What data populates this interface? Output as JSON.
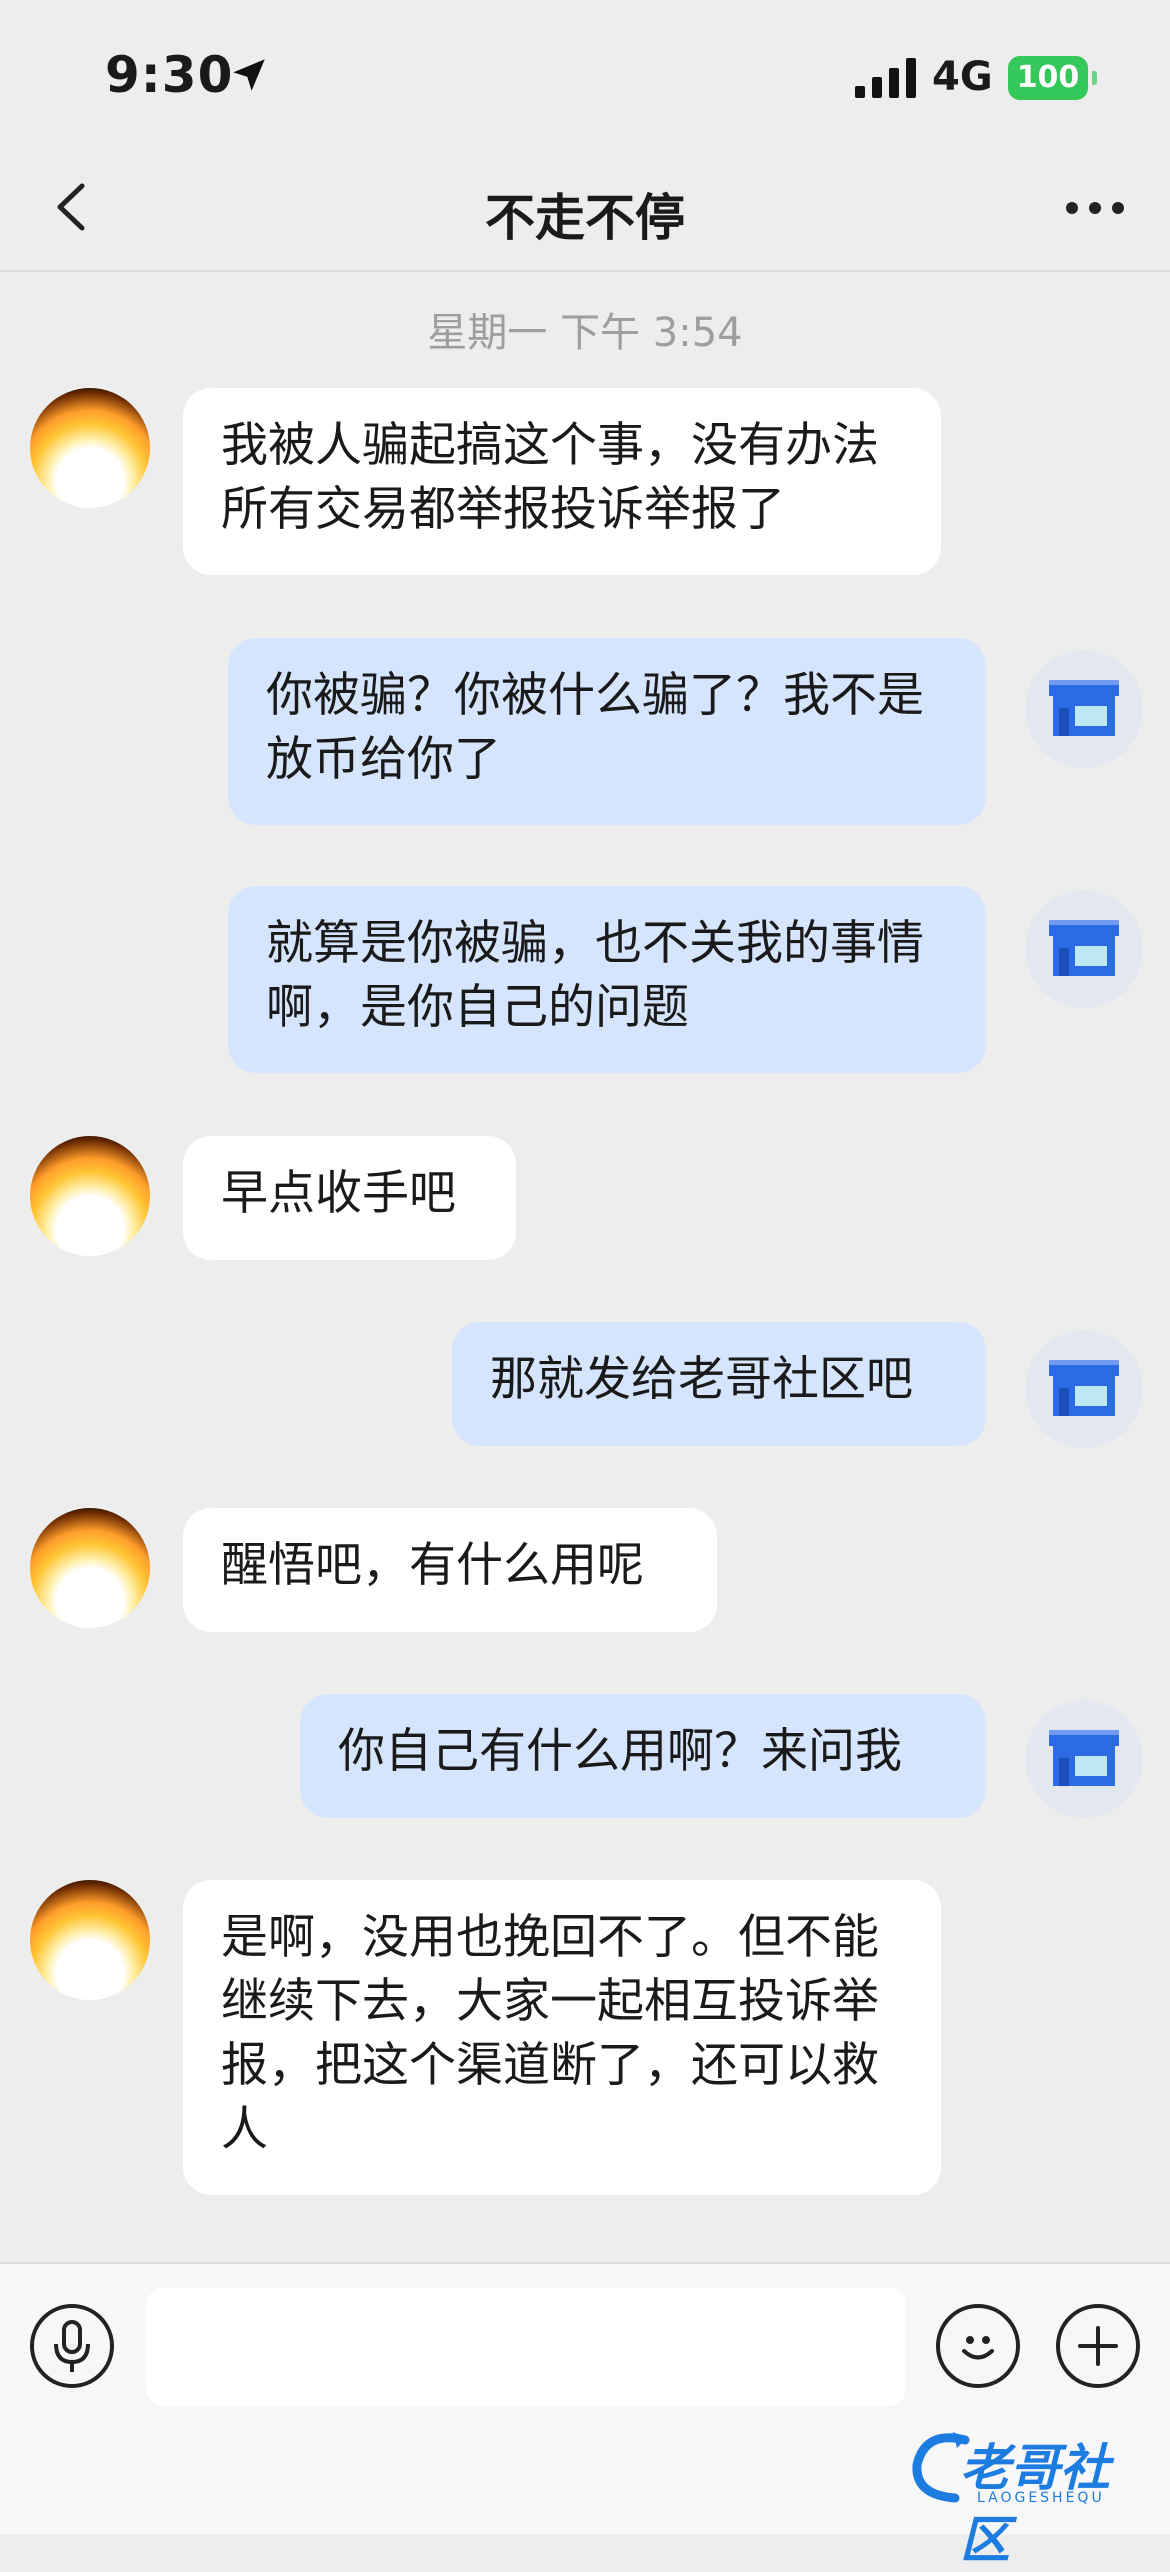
{
  "status_bar": {
    "time": "9:30",
    "network": "4G",
    "battery": "100"
  },
  "header": {
    "title": "不走不停"
  },
  "chat": {
    "timestamp": "星期一 下午 3:54",
    "messages": [
      {
        "side": "in",
        "text": "我被人骗起搞这个事，没有办法所有交易都举报投诉举报了"
      },
      {
        "side": "out",
        "text": "你被骗？你被什么骗了？我不是放币给你了"
      },
      {
        "side": "out",
        "text": "就算是你被骗，也不关我的事情啊，是你自己的问题"
      },
      {
        "side": "in",
        "text": "早点收手吧"
      },
      {
        "side": "out",
        "text": "那就发给老哥社区吧"
      },
      {
        "side": "in",
        "text": "醒悟吧，有什么用呢"
      },
      {
        "side": "out",
        "text": "你自己有什么用啊？来问我"
      },
      {
        "side": "in",
        "text": "是啊，没用也挽回不了。但不能继续下去，大家一起相互投诉举报，把这个渠道断了，还可以救人"
      }
    ]
  },
  "input_bar": {
    "value": "",
    "placeholder": ""
  },
  "icons": {
    "back": "chevron-left-icon",
    "more": "more-dots-icon",
    "voice": "microphone-icon",
    "emoji": "smiley-icon",
    "add": "plus-icon",
    "shop_avatar": "shop-icon"
  },
  "colors": {
    "background": "#EDEDED",
    "incoming_bubble": "#FFFFFF",
    "outgoing_bubble": "#D6E5FE",
    "battery": "#34C759",
    "shop_blue": "#2D6BE4"
  },
  "watermark": {
    "text": "老哥社区",
    "subtext": "LAOGESHEQU"
  }
}
